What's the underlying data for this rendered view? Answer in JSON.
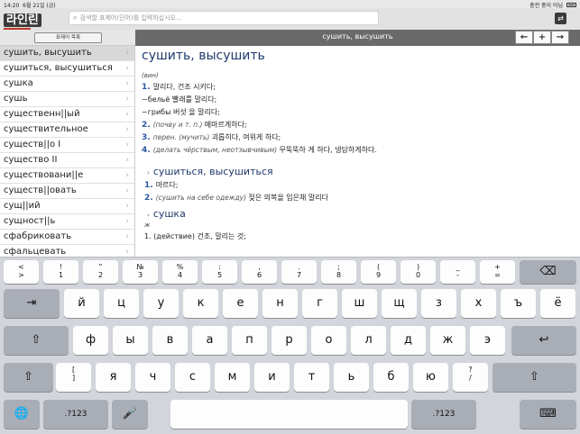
{
  "status": {
    "time": "14:20",
    "date": "6월 21일 (금)",
    "battery_label": "충전 중이 아님"
  },
  "header": {
    "logo_text": "라인린",
    "search_placeholder": "검색할 표제어(단어)를 입력하십시오...",
    "menu_icon": "swap-icon"
  },
  "left": {
    "list_button": "표제어 목록",
    "words": [
      "сушить, высушить",
      "сушиться, высушиться",
      "сушка",
      "сушь",
      "существенн||ый",
      "существительное",
      "существ||о I",
      "существо II",
      "существовани||е",
      "существ||овать",
      "сущ||ий",
      "сущност||ь",
      "сфабриковать",
      "сфальцевать"
    ],
    "selected_index": 0
  },
  "right": {
    "title": "сушить, высушить",
    "nav": [
      "←",
      "+",
      "→"
    ]
  },
  "entry": {
    "headword": "сушить, высушить",
    "gram": "(вин)",
    "senses": [
      {
        "num": "1.",
        "text": "말리다, 건조 시키다;"
      },
      {
        "num": "",
        "text": "~бельё 빨래를 말리다;"
      },
      {
        "num": "",
        "text": "~грибы 버섯 을 말리다;"
      },
      {
        "num": "2.",
        "note": "(почву и т. п.)",
        "text": "메마르게하다;"
      },
      {
        "num": "3.",
        "note": "перен. (мучить)",
        "text": "괴롭히다, 여위게 하다;"
      },
      {
        "num": "4.",
        "note": "(делать чёрствым, неотзывчивым)",
        "text": "무뚝뚝하 게 하다, 냉담하게하다."
      }
    ],
    "sub1": {
      "head": "сушиться, высушиться",
      "senses": [
        {
          "num": "1.",
          "note": "",
          "text": "마르다;"
        },
        {
          "num": "2.",
          "note": "(сушить на себе одежду)",
          "text": "젖은 의복을 입은채 말리다"
        }
      ]
    },
    "sub2": {
      "head": "сушка",
      "gram": "ж",
      "first": "1. (действие) 건조, 말리는 것;"
    }
  },
  "keyboard": {
    "row1": [
      {
        "t": "<",
        "b": ">"
      },
      {
        "t": "!",
        "b": "1"
      },
      {
        "t": "\"",
        "b": "2"
      },
      {
        "t": "№",
        "b": "3"
      },
      {
        "t": "%",
        "b": "4"
      },
      {
        "t": ":",
        "b": "5"
      },
      {
        "t": ",",
        "b": "6"
      },
      {
        "t": ".",
        "b": "7"
      },
      {
        "t": ";",
        "b": "8"
      },
      {
        "t": "(",
        "b": "9"
      },
      {
        "t": ")",
        "b": "0"
      },
      {
        "t": "_",
        "b": "-"
      },
      {
        "t": "+",
        "b": "="
      }
    ],
    "row2": [
      "й",
      "ц",
      "у",
      "к",
      "е",
      "н",
      "г",
      "ш",
      "щ",
      "з",
      "х",
      "ъ",
      "ё"
    ],
    "row3": [
      "ф",
      "ы",
      "в",
      "а",
      "п",
      "р",
      "о",
      "л",
      "д",
      "ж",
      "э"
    ],
    "row4": [
      "я",
      "ч",
      "с",
      "м",
      "и",
      "т",
      "ь",
      "б",
      "ю"
    ],
    "bracket": {
      "t": "[",
      "b": "]"
    },
    "question": {
      "t": "?",
      "b": "/"
    },
    "numkey": ".?123",
    "icons": {
      "delete": "⌫",
      "tab": "⇥",
      "shift": "⇧",
      "return": "↩",
      "globe": "🌐",
      "mic": "🎤",
      "hide": "⌨"
    }
  }
}
